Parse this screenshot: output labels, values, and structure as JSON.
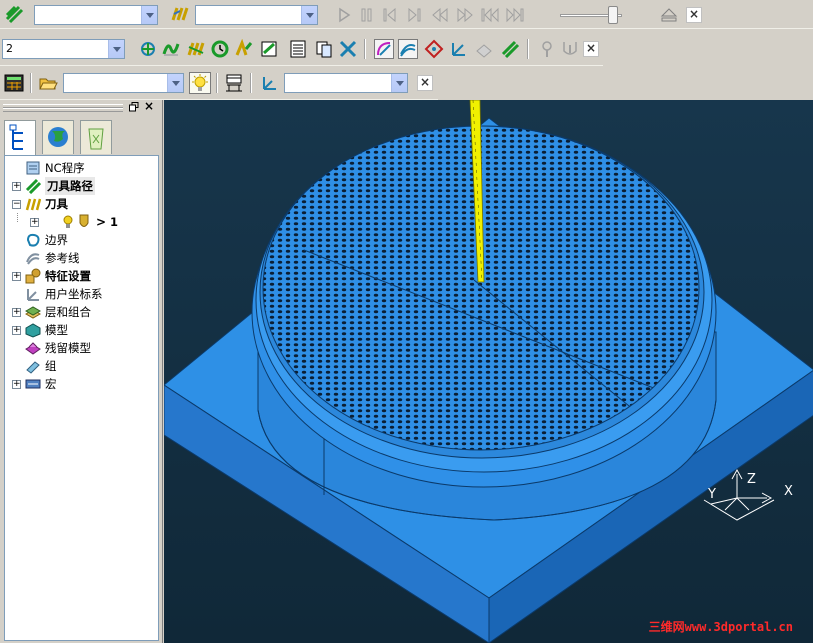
{
  "toolbar1": {
    "combo1_value": "",
    "combo2_value": "",
    "slider_level": 1.0
  },
  "toolbar2": {
    "combo_value": "2"
  },
  "toolbar3": {
    "combo1_value": "",
    "combo2_value": ""
  },
  "explorer": {
    "tabs": [
      "explorer-tree-icon",
      "globe-icon",
      "recycle-icon"
    ],
    "items": [
      {
        "label": "NC程序",
        "bold": false,
        "expand": false
      },
      {
        "label": "刀具路径",
        "bold": true,
        "expand": true
      },
      {
        "label": "刀具",
        "bold": true,
        "expand": true,
        "open": true
      },
      {
        "label": "1",
        "bold": true,
        "expand": true
      },
      {
        "label": "边界",
        "bold": false,
        "expand": false
      },
      {
        "label": "参考线",
        "bold": false,
        "expand": false
      },
      {
        "label": "特征设置",
        "bold": true,
        "expand": true
      },
      {
        "label": "用户坐标系",
        "bold": false,
        "expand": false
      },
      {
        "label": "层和组合",
        "bold": false,
        "expand": true
      },
      {
        "label": "模型",
        "bold": false,
        "expand": true
      },
      {
        "label": "残留模型",
        "bold": false,
        "expand": false
      },
      {
        "label": "组",
        "bold": false,
        "expand": false
      },
      {
        "label": "宏",
        "bold": false,
        "expand": true
      }
    ]
  },
  "viewport": {
    "axis": {
      "x": "X",
      "y": "Y",
      "z": "Z"
    },
    "watermark": "三维网www.3dportal.cn",
    "colors": {
      "model": "#2d8fe0",
      "background": "#14304a",
      "tool": "#f0f000"
    }
  }
}
